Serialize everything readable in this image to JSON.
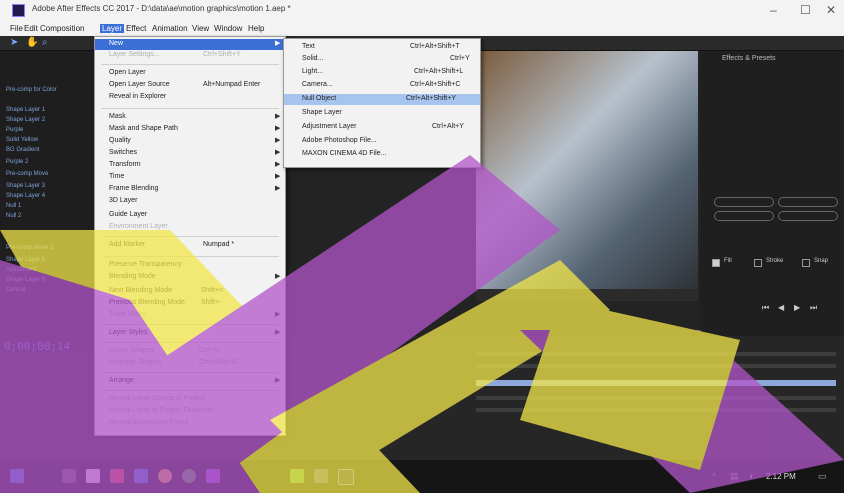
{
  "window": {
    "title": "Adobe After Effects CC 2017 - D:\\data\\ae\\motion graphics\\motion 1.aep *",
    "minimize": "–",
    "maximize": "☐",
    "close": "✕"
  },
  "menubar": [
    "File",
    "Edit",
    "Composition",
    "Layer",
    "Effect",
    "Animation",
    "View",
    "Window",
    "Help"
  ],
  "layer_menu": {
    "items": [
      {
        "label": "New",
        "shortcut": "",
        "submenu": true,
        "state": "selected"
      },
      {
        "label": "Layer Settings...",
        "shortcut": "Ctrl+Shift+Y",
        "state": "disabled"
      },
      {
        "label": "Open Layer",
        "shortcut": ""
      },
      {
        "label": "Open Layer Source",
        "shortcut": "Alt+Numpad Enter"
      },
      {
        "label": "Reveal in Explorer",
        "shortcut": ""
      },
      {
        "label": "Mask",
        "shortcut": "",
        "submenu": true
      },
      {
        "label": "Mask and Shape Path",
        "shortcut": "",
        "submenu": true
      },
      {
        "label": "Quality",
        "shortcut": "",
        "submenu": true
      },
      {
        "label": "Switches",
        "shortcut": "",
        "submenu": true
      },
      {
        "label": "Transform",
        "shortcut": "",
        "submenu": true
      },
      {
        "label": "Time",
        "shortcut": "",
        "submenu": true
      },
      {
        "label": "Frame Blending",
        "shortcut": "",
        "submenu": true
      },
      {
        "label": "3D Layer",
        "shortcut": ""
      },
      {
        "label": "Guide Layer",
        "shortcut": ""
      },
      {
        "label": "Environment Layer",
        "shortcut": "",
        "state": "disabled"
      },
      {
        "label": "Add Marker",
        "shortcut": "Numpad *"
      },
      {
        "label": "Preserve Transparency",
        "shortcut": ""
      },
      {
        "label": "Blending Mode",
        "shortcut": "",
        "submenu": true
      },
      {
        "label": "Next Blending Mode",
        "shortcut": "Shift+="
      },
      {
        "label": "Previous Blending Mode",
        "shortcut": "Shift+-"
      },
      {
        "label": "Track Matte",
        "shortcut": "",
        "submenu": true,
        "state": "disabled"
      },
      {
        "label": "Layer Styles",
        "shortcut": "",
        "submenu": true
      },
      {
        "label": "Group Shapes",
        "shortcut": "Ctrl+G",
        "state": "disabled"
      },
      {
        "label": "Ungroup Shapes",
        "shortcut": "Ctrl+Shift+G",
        "state": "disabled"
      },
      {
        "label": "Arrange",
        "shortcut": "",
        "submenu": true
      },
      {
        "label": "Reveal Layer Source in Project",
        "shortcut": "",
        "state": "disabled"
      },
      {
        "label": "Reveal Layer in Project Flowchart",
        "shortcut": "",
        "state": "disabled"
      },
      {
        "label": "Reveal Expression Errors",
        "shortcut": "",
        "state": "disabled"
      }
    ]
  },
  "new_submenu": {
    "items": [
      {
        "label": "Text",
        "shortcut": "Ctrl+Alt+Shift+T"
      },
      {
        "label": "Solid...",
        "shortcut": "Ctrl+Y"
      },
      {
        "label": "Light...",
        "shortcut": "Ctrl+Alt+Shift+L"
      },
      {
        "label": "Camera...",
        "shortcut": "Ctrl+Alt+Shift+C"
      },
      {
        "label": "Null Object",
        "shortcut": "Ctrl+Alt+Shift+Y",
        "state": "highlighted"
      },
      {
        "label": "Shape Layer",
        "shortcut": ""
      },
      {
        "label": "Adjustment Layer",
        "shortcut": "Ctrl+Alt+Y"
      },
      {
        "label": "Adobe Photoshop File...",
        "shortcut": ""
      },
      {
        "label": "MAXON CINEMA 4D File...",
        "shortcut": ""
      }
    ]
  },
  "project_panel": {
    "rows": [
      "Pre-comp for Color",
      "Shape Layer 1",
      "Shape Layer 2",
      "Purple",
      "Solid Yellow",
      "BG Gradient",
      "Purple 2",
      "Pre-comp Move",
      "Shape Layer 3",
      "Shape Layer 4",
      "Null 1",
      "Null 2",
      "Pre-comp Move 2",
      "Shape Layer 5",
      "Adjustment",
      "Shape Layer 6",
      "Control"
    ]
  },
  "timeline": {
    "timecode": "0;00;00;14"
  },
  "right_panel": {
    "title": "Effects & Presets",
    "checkbox_labels": [
      "Fill",
      "Stroke",
      "Snap"
    ]
  },
  "taskbar": {
    "clock": "2:12 PM"
  },
  "colors": {
    "menu_bg": "#f2f2f2",
    "menu_selected": "#3b6fd6",
    "menu_highlight": "#a6c4ee",
    "timecode": "#5a7dd8",
    "watermark_purple": "#b255c9",
    "watermark_yellow": "#f2e64a"
  }
}
